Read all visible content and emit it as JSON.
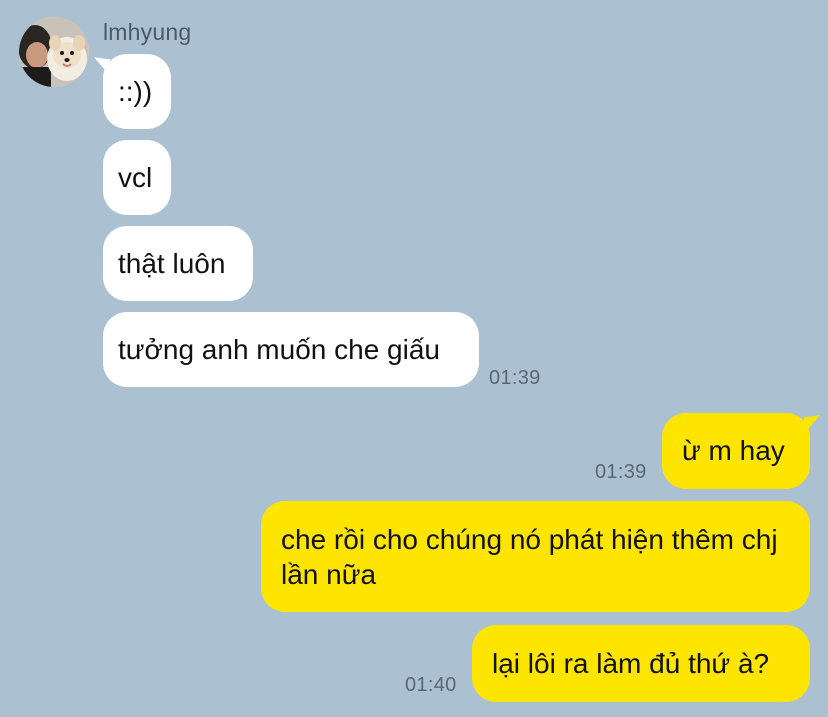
{
  "contact": {
    "name": "lmhyung",
    "avatar_icon": "profile-photo-man-with-pomeranian"
  },
  "colors": {
    "background": "#abc1d1",
    "incoming_bubble": "#ffffff",
    "outgoing_bubble": "#fee500",
    "timestamp": "#5b6874"
  },
  "messages": {
    "incoming": [
      {
        "text": "::))"
      },
      {
        "text": "vcl"
      },
      {
        "text": "thật luôn"
      },
      {
        "text": "tưởng anh muốn che giấu",
        "time": "01:39"
      }
    ],
    "outgoing": [
      {
        "text": "ừ m hay",
        "time": "01:39"
      },
      {
        "text": "che rồi cho chúng nó phát hiện thêm chj lần nữa"
      },
      {
        "text": "lại lôi ra làm đủ thứ à?",
        "time": "01:40"
      }
    ]
  }
}
